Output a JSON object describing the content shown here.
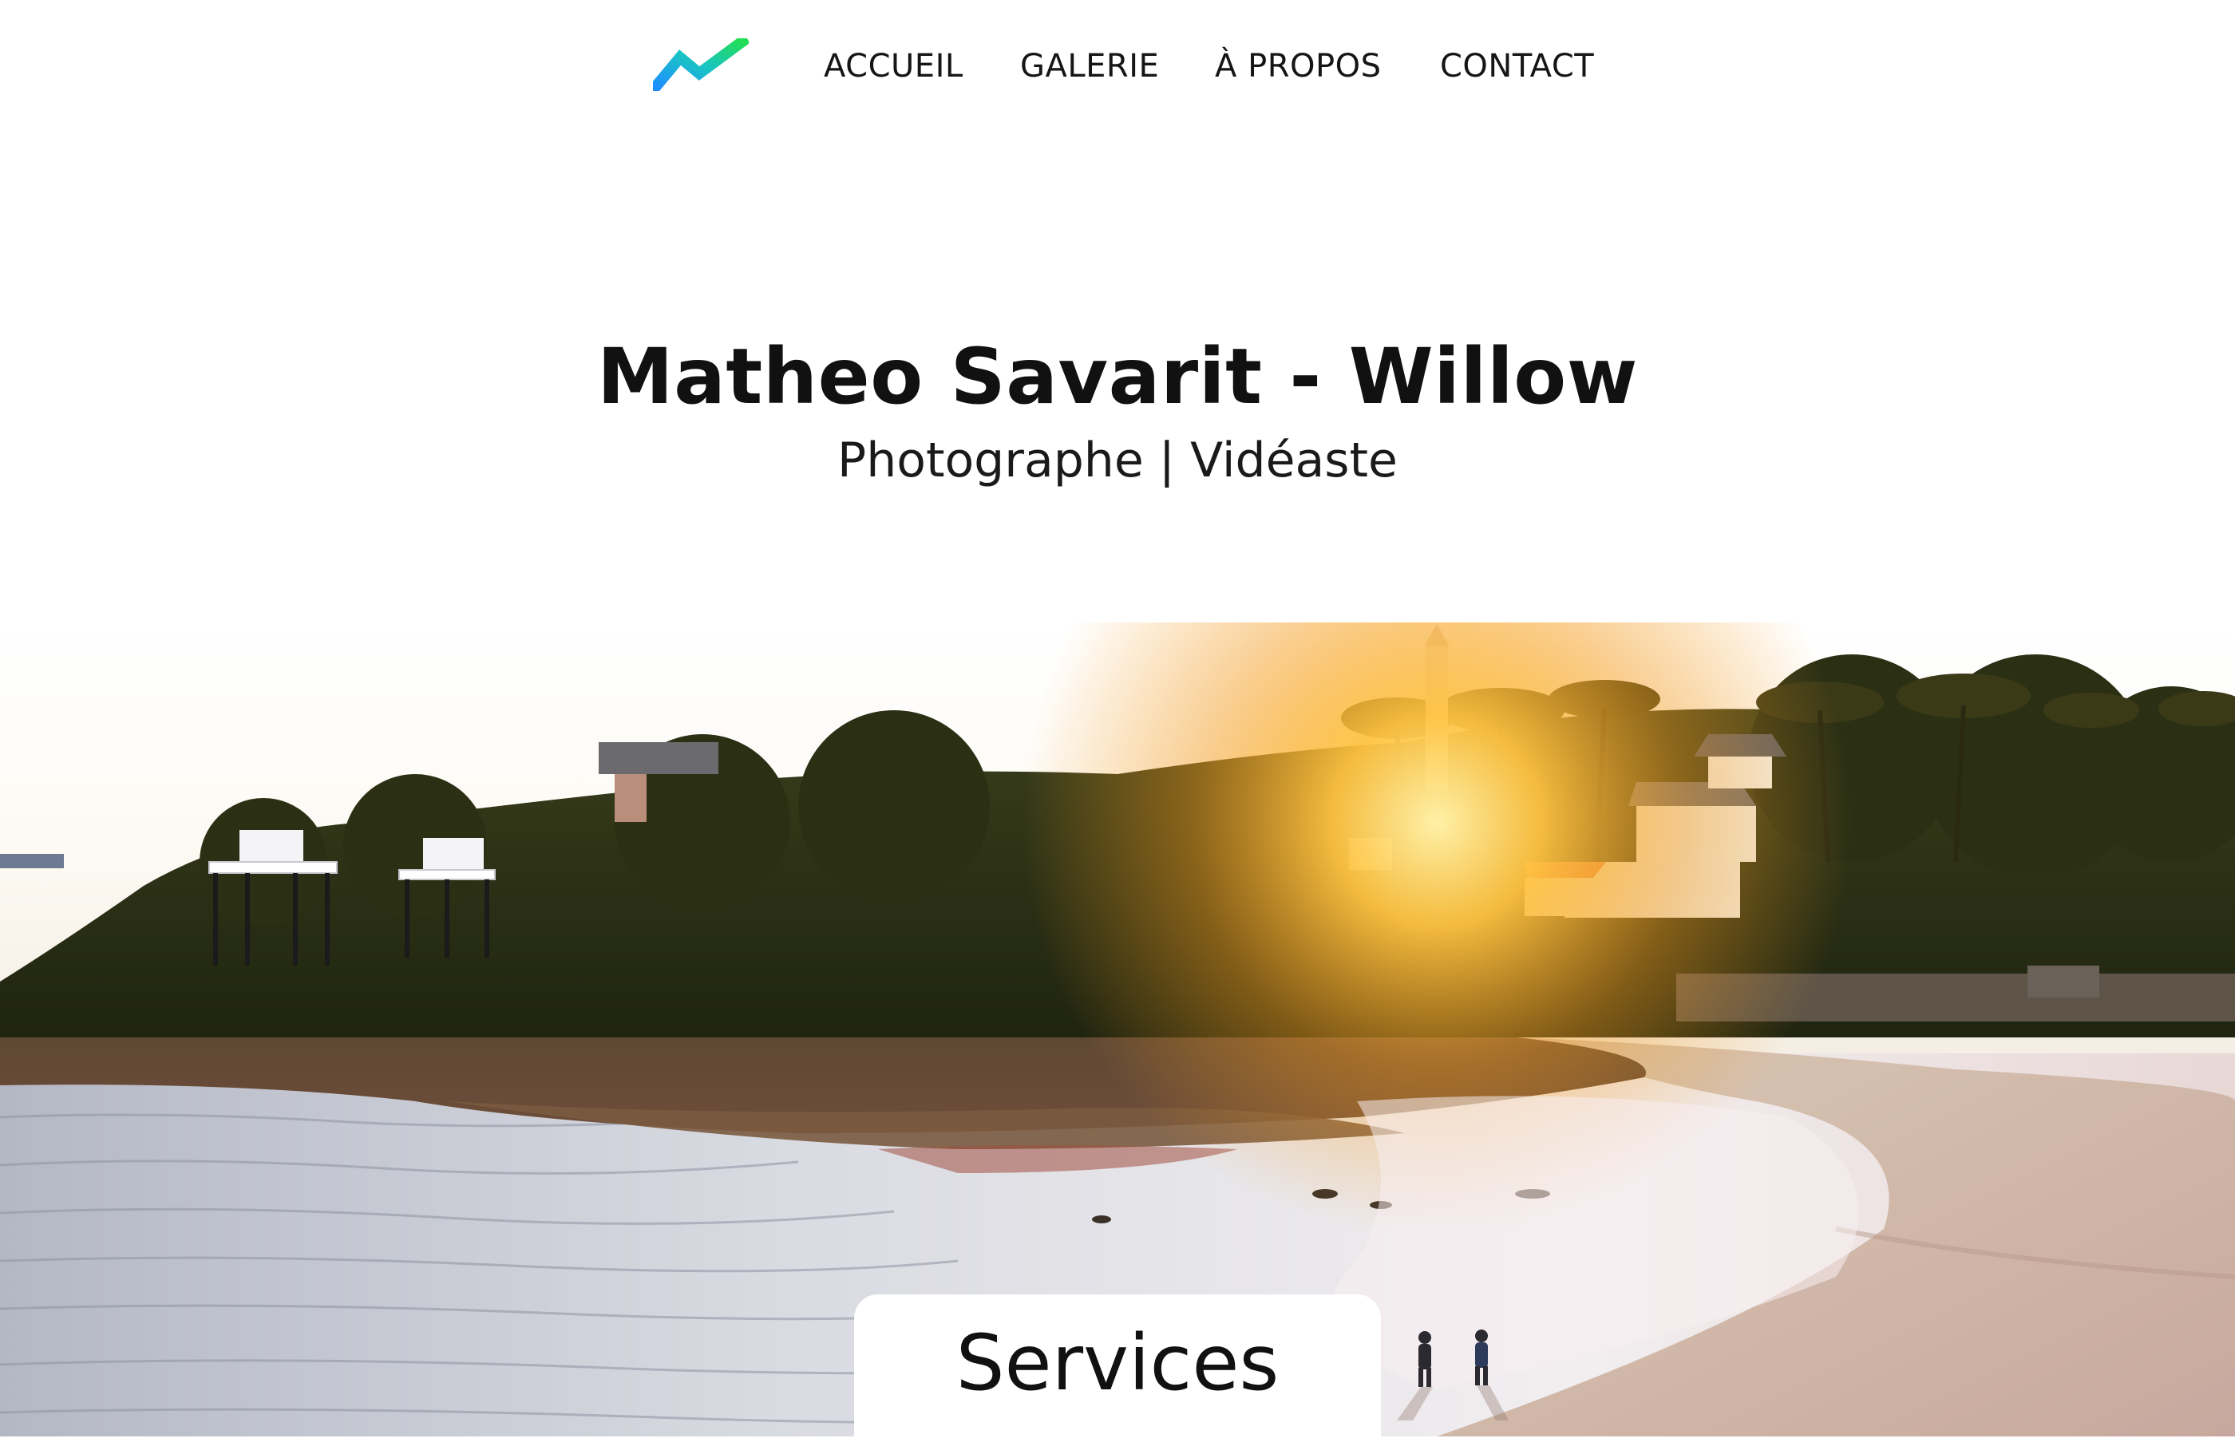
{
  "nav": {
    "logo_icon": "zigzag-logo-icon",
    "items": [
      {
        "label": "ACCUEIL"
      },
      {
        "label": "GALERIE"
      },
      {
        "label": "À PROPOS"
      },
      {
        "label": "CONTACT"
      }
    ]
  },
  "hero": {
    "title": "Matheo Savarit - Willow",
    "subtitle": "Photographe | Vidéaste",
    "image_description": "coastal-sunset-beach-photo"
  },
  "services": {
    "title": "Services"
  },
  "colors": {
    "logo_gradient_start": "#1e90ff",
    "logo_gradient_end": "#22dd55",
    "text": "#111111",
    "background": "#ffffff"
  }
}
